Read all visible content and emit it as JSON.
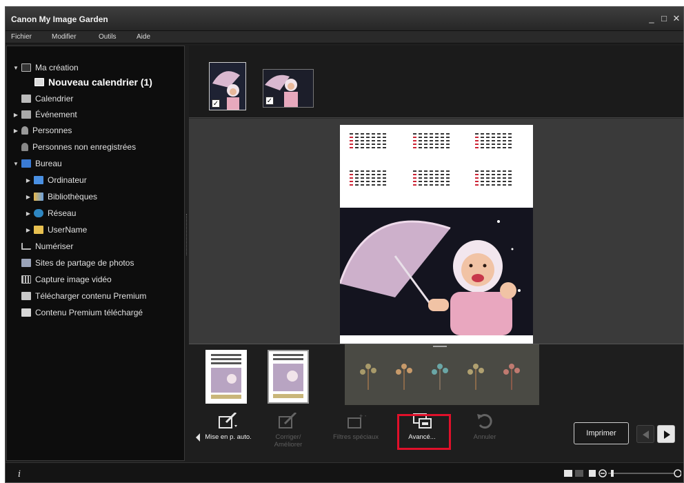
{
  "window": {
    "title": "Canon My Image Garden",
    "controls": [
      "_",
      "□",
      "✕"
    ]
  },
  "menu": [
    "Fichier",
    "Modifier",
    "Outils",
    "Aide"
  ],
  "sidebar": {
    "items": [
      {
        "label": "Ma création",
        "icon": "my-art-icon",
        "expander": "▼"
      },
      {
        "label": "Nouveau calendrier (1)",
        "icon": "calendar-item-icon",
        "expander": ""
      },
      {
        "label": "Calendrier",
        "icon": "calendar-icon",
        "expander": ""
      },
      {
        "label": "Événement",
        "icon": "event-icon",
        "expander": "▶"
      },
      {
        "label": "Personnes",
        "icon": "person-icon",
        "expander": "▶"
      },
      {
        "label": "Personnes non enregistrées",
        "icon": "unregistered-person-icon",
        "expander": ""
      },
      {
        "label": "Bureau",
        "icon": "desktop-icon",
        "expander": "▼"
      },
      {
        "label": "Ordinateur",
        "icon": "computer-icon",
        "expander": "▶"
      },
      {
        "label": "Bibliothèques",
        "icon": "libraries-icon",
        "expander": "▶"
      },
      {
        "label": "Réseau",
        "icon": "network-icon",
        "expander": "▶"
      },
      {
        "label": "UserName",
        "icon": "user-folder-icon",
        "expander": "▶"
      },
      {
        "label": "Numériser",
        "icon": "scan-icon",
        "expander": ""
      },
      {
        "label": "Sites de partage de photos",
        "icon": "photo-sharing-icon",
        "expander": ""
      },
      {
        "label": "Capture image vidéo",
        "icon": "video-capture-icon",
        "expander": ""
      },
      {
        "label": "Télécharger contenu Premium",
        "icon": "download-premium-icon",
        "expander": ""
      },
      {
        "label": "Contenu Premium téléchargé",
        "icon": "folder-icon",
        "expander": ""
      }
    ]
  },
  "toolbar": {
    "auto_layout": "Mise en p. auto.",
    "correct": "Corriger/ Améliorer",
    "filters": "Filtres spéciaux",
    "advanced": "Avancé...",
    "undo": "Annuler",
    "print": "Imprimer"
  },
  "colors": {
    "highlight": "#e0102a",
    "background": "#1e1e1e"
  }
}
